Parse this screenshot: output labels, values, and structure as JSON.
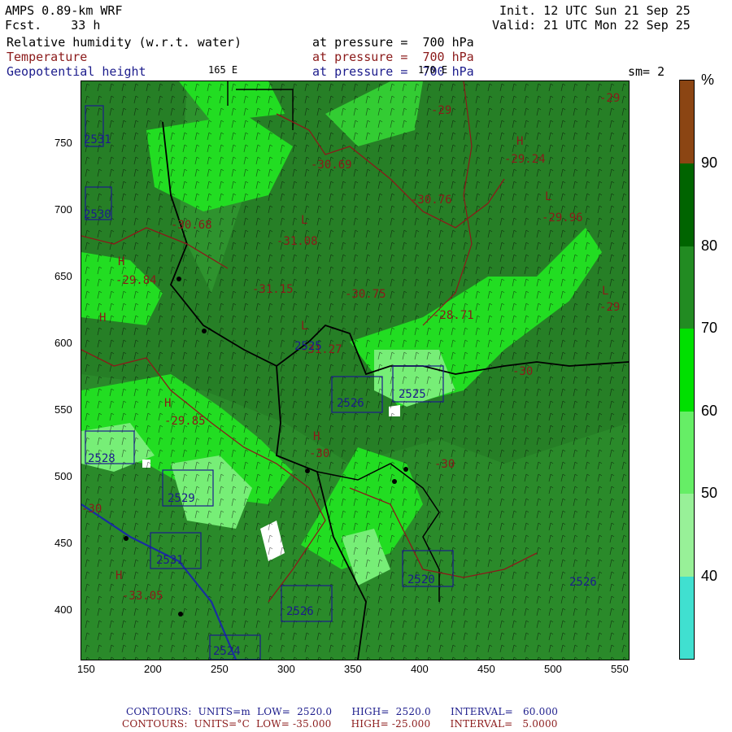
{
  "header": {
    "model": "AMPS 0.89-km WRF",
    "forecast": "Fcst.    33 h",
    "init": "Init. 12 UTC Sun 21 Sep 25",
    "valid": "Valid: 21 UTC Mon 22 Sep 25",
    "fields": [
      {
        "name": "Relative humidity (w.r.t. water)",
        "level": "at pressure =  700 hPa",
        "color": "#000000"
      },
      {
        "name": "Temperature",
        "level": "at pressure =  700 hPa",
        "color": "#8b1a1a"
      },
      {
        "name": "Geopotential height",
        "level": "at pressure =  700 hPa",
        "color": "#1c1c8c"
      }
    ],
    "lon_label_1": "165 E",
    "lon_label_2": "170 E",
    "smoothing": "sm= 2"
  },
  "axes": {
    "x_ticks": [
      "150",
      "200",
      "250",
      "300",
      "350",
      "400",
      "450",
      "500",
      "550"
    ],
    "y_ticks": [
      "750",
      "700",
      "650",
      "600",
      "550",
      "500",
      "450",
      "400"
    ]
  },
  "colorbar": {
    "unit": "%",
    "labels": [
      "90",
      "80",
      "70",
      "60",
      "50",
      "40"
    ],
    "colors": [
      "#8b4513",
      "#006400",
      "#228b22",
      "#00e000",
      "#66ee66",
      "#98f098",
      "#40e0d0"
    ]
  },
  "map_labels": {
    "temperature": [
      "-29",
      "-29.24",
      "-29.96",
      "-30.76",
      "-30.69",
      "-30.68",
      "-31.08",
      "-29.84",
      "-31.15",
      "-30.75",
      "-28.71",
      "-29",
      "-31.27",
      "-29.85",
      "-30",
      "-30",
      "-33.05",
      "-30",
      "-30",
      "-29"
    ],
    "height": [
      "2531",
      "2530",
      "2528",
      "2529",
      "2531",
      "2526",
      "2525",
      "2520",
      "2526",
      "2524",
      "2525",
      "2526"
    ],
    "markers": [
      "H",
      "L"
    ]
  },
  "footer": {
    "line1": "CONTOURS:  UNITS=m  LOW=  2520.0      HIGH=  2520.0      INTERVAL=   60.000",
    "line2": "CONTOURS:  UNITS=°C  LOW= -35.000      HIGH= -25.000      INTERVAL=   5.0000"
  }
}
